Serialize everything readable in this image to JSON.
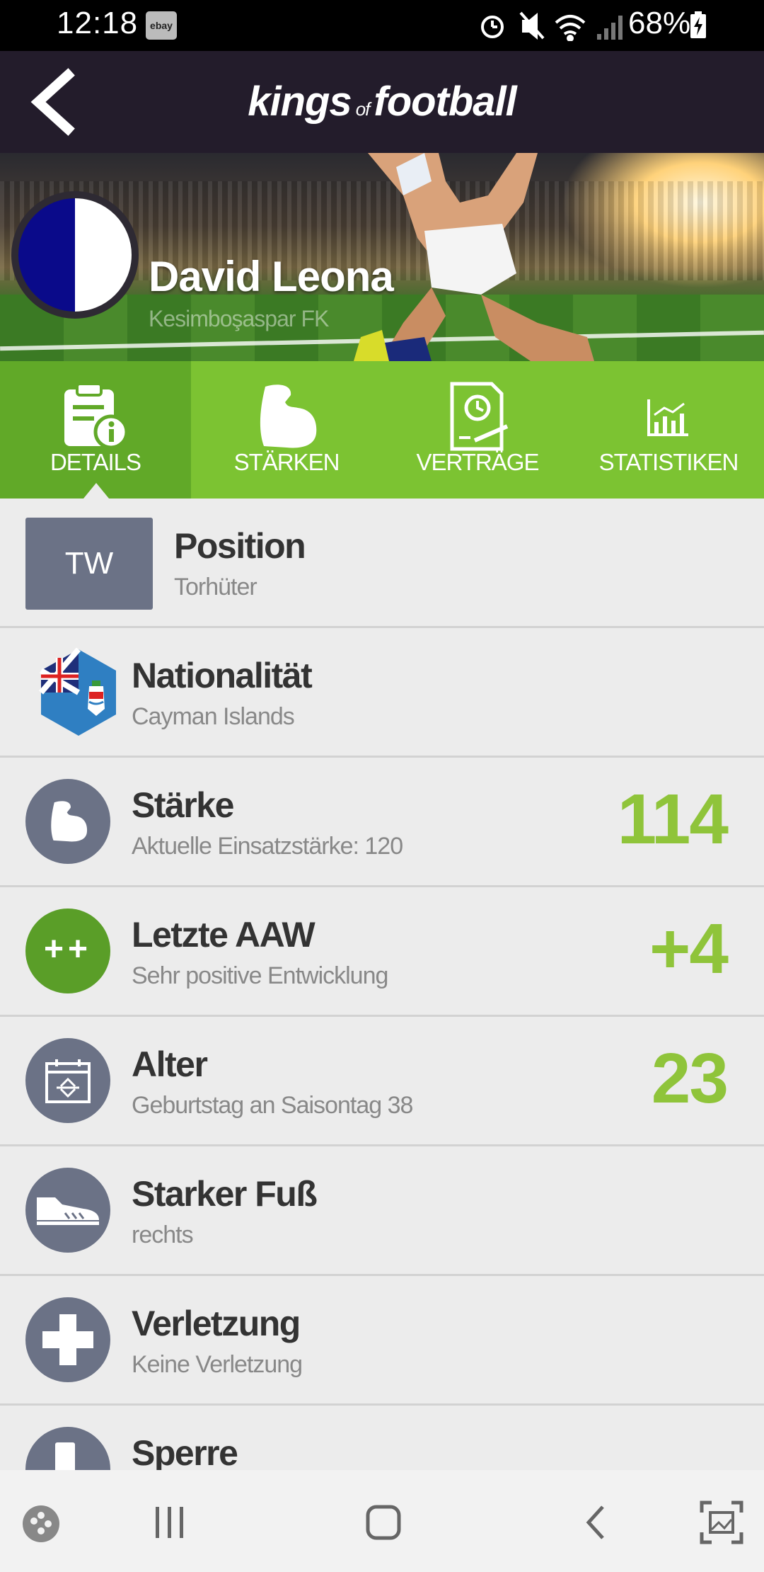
{
  "status_bar": {
    "time": "12:18",
    "notification_app": "ebay",
    "battery": "68%",
    "icons": [
      "alarm-icon",
      "mute-icon",
      "wifi-icon",
      "signal-icon",
      "battery-icon"
    ]
  },
  "app_bar": {
    "logo_word1": "kings",
    "logo_word2": "of",
    "logo_word3": "football",
    "back_icon": "chevron-left-icon"
  },
  "player": {
    "name": "David Leona",
    "club": "Kesimboşaspar FK"
  },
  "tabs": [
    {
      "label": "DETAILS",
      "icon": "clipboard-info-icon",
      "active": true
    },
    {
      "label": "STÄRKEN",
      "icon": "bicep-icon",
      "active": false
    },
    {
      "label": "VERTRÄGE",
      "icon": "contract-icon",
      "active": false
    },
    {
      "label": "STATISTIKEN",
      "icon": "chart-icon",
      "active": false
    }
  ],
  "details": {
    "position": {
      "badge": "TW",
      "title": "Position",
      "subtitle": "Torhüter"
    },
    "nationality": {
      "title": "Nationalität",
      "subtitle": "Cayman Islands",
      "icon": "cayman-islands-flag-icon"
    },
    "strength": {
      "title": "Stärke",
      "subtitle": "Aktuelle Einsatzstärke: 120",
      "value": "114",
      "icon": "bicep-icon"
    },
    "last_aaw": {
      "title": "Letzte AAW",
      "subtitle": "Sehr positive Entwicklung",
      "value": "+4",
      "badge": "++"
    },
    "age": {
      "title": "Alter",
      "subtitle": "Geburtstag an Saisontag 38",
      "value": "23",
      "icon": "calendar-icon"
    },
    "strong_foot": {
      "title": "Starker Fuß",
      "subtitle": "rechts",
      "icon": "boot-icon"
    },
    "injury": {
      "title": "Verletzung",
      "subtitle": "Keine Verletzung",
      "icon": "medical-cross-icon"
    },
    "suspension": {
      "title": "Sperre",
      "icon": "card-icon"
    }
  },
  "colors": {
    "header_bg": "#231c2b",
    "tab_bg": "#7cc332",
    "tab_active_bg": "#61a928",
    "value_green": "#8fc43a",
    "icon_grey": "#6b7286",
    "aaw_green": "#5a9e28"
  },
  "nav_bar": {
    "icons": [
      "game-launcher-icon",
      "recents-icon",
      "home-icon",
      "back-icon",
      "screenshot-icon"
    ]
  }
}
